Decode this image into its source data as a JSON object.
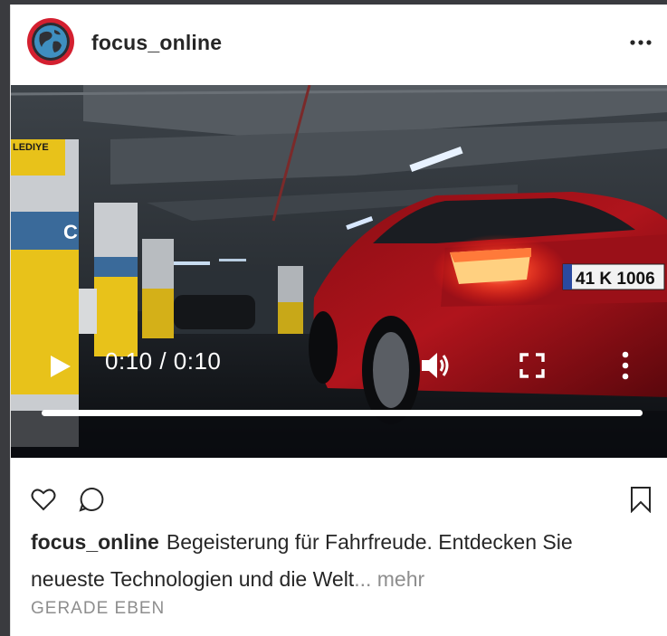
{
  "post": {
    "username": "focus_online",
    "avatar_icon": "globe-icon",
    "menu_icon": "more-horizontal-icon"
  },
  "video": {
    "time": "0:10 / 0:10",
    "progress": 1.0,
    "sign_text": "LEDIYE",
    "plate_text": "41 K 1006",
    "pillar_letter": "C",
    "icons": [
      "play-icon",
      "volume-icon",
      "fullscreen-icon",
      "more-vertical-icon"
    ]
  },
  "actions": {
    "icons": [
      "heart-icon",
      "comment-icon",
      "bookmark-icon"
    ]
  },
  "caption": {
    "username": "focus_online",
    "text": "Begeisterung für Fahrfreude. Entdecken Sie neueste Technologien und die Welt",
    "ellipsis": "...",
    "more": " mehr"
  },
  "timestamp": "GERADE EBEN",
  "colors": {
    "avatar_ring": "#d42030",
    "car_red": "#b0141c",
    "ceiling": "#4a5056",
    "pillar_yellow": "#e8c21a"
  }
}
